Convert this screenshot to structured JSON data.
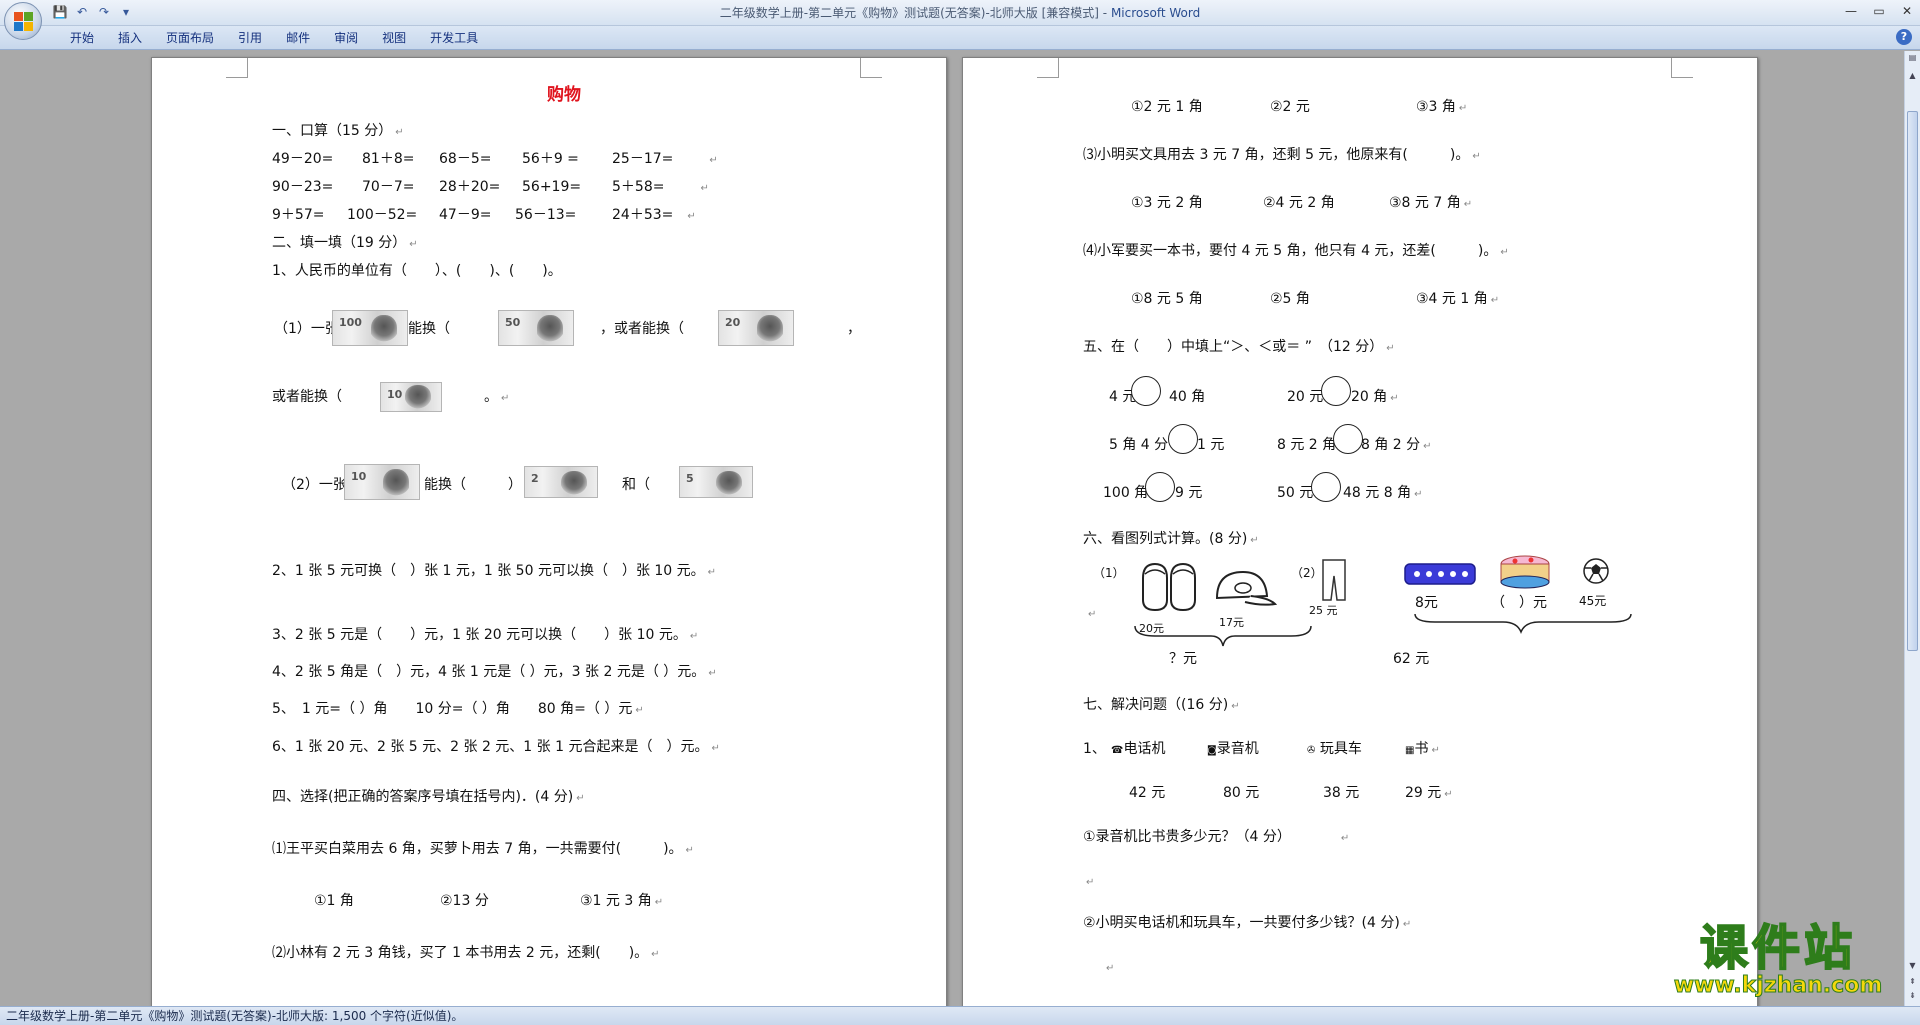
{
  "window": {
    "title": "二年级数学上册-第二单元《购物》测试题(无答案)-北师大版 [兼容模式] - ",
    "app_name": "Microsoft Word"
  },
  "qat": {
    "save": "💾",
    "undo": "↶",
    "redo": "↷",
    "more": "▾"
  },
  "window_controls": {
    "minimize": "—",
    "maximize": "▭",
    "close": "✕"
  },
  "ribbon": {
    "tabs": [
      "开始",
      "插入",
      "页面布局",
      "引用",
      "邮件",
      "审阅",
      "视图",
      "开发工具"
    ],
    "help": "?"
  },
  "page1": {
    "title": "购物",
    "sec1": "一、口算（15 分）",
    "r1": [
      "49－20=",
      "81＋8=",
      "68－5=",
      "56＋9 =",
      "25－17="
    ],
    "r2": [
      "90－23=",
      "70－7=",
      "28＋20=",
      "56+19=",
      "5＋58="
    ],
    "r3": [
      "9＋57=",
      "100－52=",
      "47－9=",
      "56－13=",
      "24＋53="
    ],
    "sec2": "二、填一填（19 分）",
    "q1": "1、人民币的单位有（　　）、(　　)、(　　)。",
    "q1a_1": "（1）一张",
    "q1a_2": "能换（",
    "q1a_3": "，或者能换（",
    "q1a_4": "，",
    "q1b_1": "或者能换（",
    "q1b_2": "。",
    "q1c_1": "（2）一张",
    "q1c_2": "能换（",
    "q1c_3": "）",
    "q1c_4": "和（",
    "q2": "2、1 张 5 元可换（　）张 1 元，1 张 50 元可以换（　）张 10 元。",
    "q3": "3、2 张 5 元是（　　）元，1 张 20 元可以换（　　）张 10 元。",
    "q4": "4、2 张 5 角是（　）元，4 张 1 元是（ ）元，3 张 2 元是（ ）元。",
    "q5": "5、　1 元=（ ）角　　10 分=（ ）角　　80 角=（ ）元",
    "q6": "6、1 张 20 元、2 张 5 元、2 张 2 元、1 张 1 元合起来是（　）元。",
    "sec4": "四、选择(把正确的答案序号填在括号内)．(4 分)",
    "c1": "⑴王平买白菜用去 6 角，买萝卜用去 7 角，一共需要付(　　　)。",
    "c1_opts": [
      "①1 角",
      "②13 分",
      "③1 元 3 角"
    ],
    "c2": "⑵小林有 2 元 3 角钱，买了 1 本书用去 2 元，还剩(　　)。"
  },
  "page2": {
    "c2_opts": [
      "①2 元 1 角",
      "②2 元",
      "③3 角"
    ],
    "c3": "⑶小明买文具用去 3 元 7 角，还剩 5 元，他原来有(　　　)。",
    "c3_opts": [
      "①3 元 2 角",
      "②4 元 2 角",
      "③8 元 7 角"
    ],
    "c4": "⑷小军要买一本书，要付 4 元 5 角，他只有 4 元，还差(　　　)。",
    "c4_opts": [
      "①8 元 5 角",
      "②5 角",
      "③4 元 1 角"
    ],
    "sec5": "五、在（　　）中填上“＞、＜或＝ ”　（12 分）",
    "cmp": [
      [
        "4 元",
        "40 角",
        "20 元",
        "20 角"
      ],
      [
        "5 角 4 分",
        "1 元",
        "8 元 2 角",
        "8 角 2 分"
      ],
      [
        "100 角",
        "9 元",
        "50 元",
        "48 元 8 角"
      ]
    ],
    "sec6": "六、看图列式计算。(8 分)",
    "p6_1": "（1）",
    "p6_2": "（2）",
    "p6_gloves": "20元",
    "p6_cap": "17元",
    "p6_pants": "25 元",
    "p6_q1": "？元",
    "p6_pencil": "8元",
    "p6_cake": "（　）元",
    "p6_ball": "45元",
    "p6_total": "62 元",
    "sec7": "七、解决问题（(16 分)",
    "items_prefix": "1、",
    "items": [
      "电话机",
      "录音机",
      "玩具车",
      "书"
    ],
    "item_icons": [
      "telephone-icon",
      "recorder-icon",
      "toy-car-icon",
      "book-icon"
    ],
    "prices": [
      "42 元",
      "80 元",
      "38 元",
      "29 元"
    ],
    "s1": "①录音机比书贵多少元？（4 分）",
    "s2": "②小明买电话机和玩具车，一共要付多少钱？(4 分)"
  },
  "status": {
    "text": "二年级数学上册-第二单元《购物》测试题(无答案)-北师大版: 1,500 个字符(近似值)。"
  },
  "watermark": {
    "big": "课件站",
    "small": "www.kjzhan.com"
  },
  "colors": {
    "title_red": "#e0141e",
    "ribbon_text": "#15317e",
    "watermark_fill": "#f5d80b",
    "watermark_stroke": "#2e7d1b"
  }
}
